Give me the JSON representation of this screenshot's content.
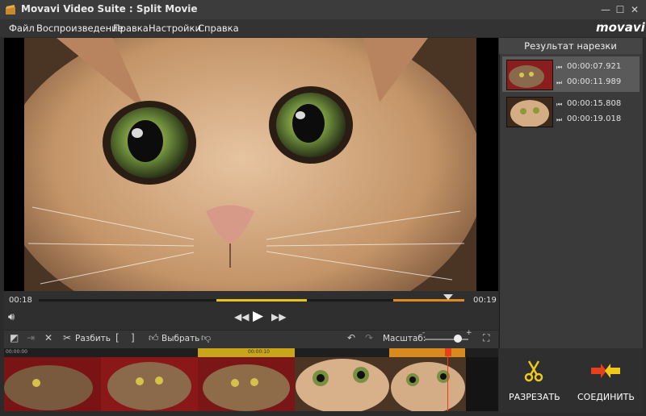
{
  "window": {
    "title": "Movavi Video Suite : Split Movie",
    "minimize": "—",
    "maximize": "☐",
    "close": "✕"
  },
  "menu": [
    "Файл",
    "Воспроизведение",
    "Правка",
    "Настройки",
    "Справка"
  ],
  "logo": "movavi",
  "results": {
    "header": "Результат нарезки",
    "clips": [
      {
        "start": "00:00:07.921",
        "end": "00:00:11.989"
      },
      {
        "start": "00:00:15.808",
        "end": "00:00:19.018"
      }
    ]
  },
  "player": {
    "current_time": "00:18",
    "end_time": "00:19",
    "icons": {
      "volume": "volume-icon",
      "rewind": "rewind-icon",
      "play": "play-icon",
      "forward": "fast-forward-icon"
    }
  },
  "toolbar": {
    "split_label": "Разбить",
    "select_label": "Выбрать",
    "zoom_label": "Масштаб:",
    "bracket_open": "[",
    "bracket_close": "]",
    "zoom_minus": "-",
    "zoom_plus": "+",
    "zoom_level": 0.75
  },
  "timeline": {
    "ruler_marks": [
      "00:00:00",
      "00:00:10"
    ]
  },
  "actions": {
    "cut_label": "РАЗРЕЗАТЬ",
    "join_label": "СОЕДИНИТЬ"
  },
  "colors": {
    "accent_yellow": "#e8c21c",
    "accent_orange": "#e08a1e",
    "cut_red": "#e8401c"
  }
}
